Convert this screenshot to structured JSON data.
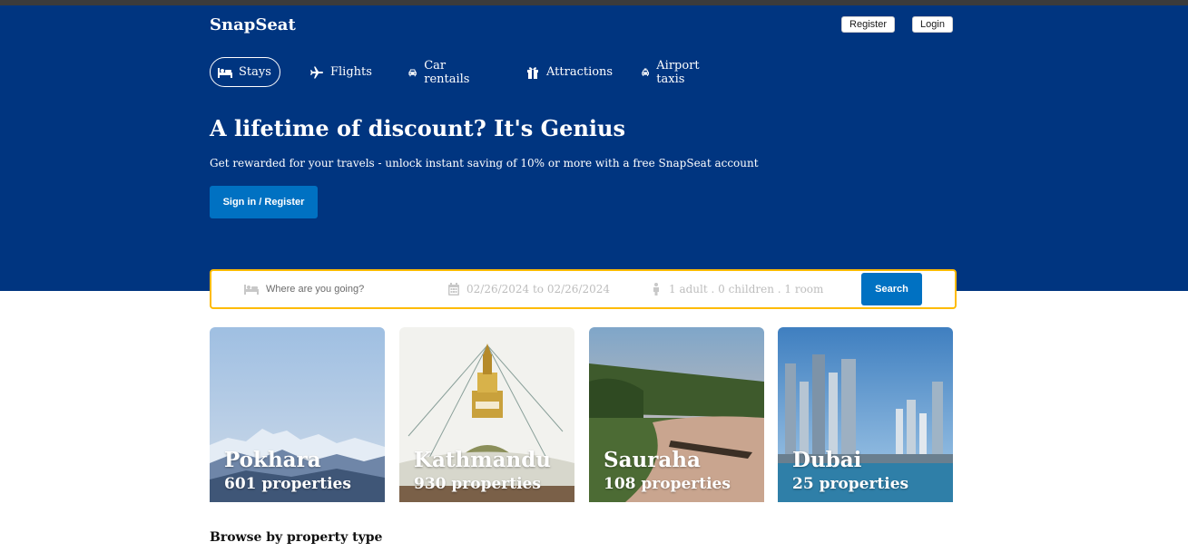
{
  "brand": {
    "name": "SnapSeat"
  },
  "header": {
    "register_label": "Register",
    "login_label": "Login"
  },
  "nav": {
    "items": [
      {
        "label": "Stays",
        "icon": "bed-icon",
        "active": true
      },
      {
        "label": "Flights",
        "icon": "plane-icon"
      },
      {
        "label": "Car rentails",
        "icon": "car-icon"
      },
      {
        "label": "Attractions",
        "icon": "gift-icon"
      },
      {
        "label": "Airport taxis",
        "icon": "taxi-icon"
      }
    ]
  },
  "hero": {
    "title": "A lifetime of discount? It's Genius",
    "subtitle": "Get rewarded for your travels - unlock instant saving of 10% or more with a free SnapSeat account",
    "cta_label": "Sign in / Register"
  },
  "search": {
    "destination_placeholder": "Where are you going?",
    "date_range": "02/26/2024 to 02/26/2024",
    "guests": "1 adult . 0 children . 1 room",
    "button_label": "Search"
  },
  "destinations": [
    {
      "name": "Pokhara",
      "properties": "601 properties"
    },
    {
      "name": "Kathmandu",
      "properties": "930 properties"
    },
    {
      "name": "Sauraha",
      "properties": "108 properties"
    },
    {
      "name": "Dubai",
      "properties": "25 properties"
    }
  ],
  "sections": {
    "browse_title": "Browse by property type"
  },
  "colors": {
    "brand_blue": "#003580",
    "button_blue": "#0071c2",
    "search_border": "#febb02"
  }
}
